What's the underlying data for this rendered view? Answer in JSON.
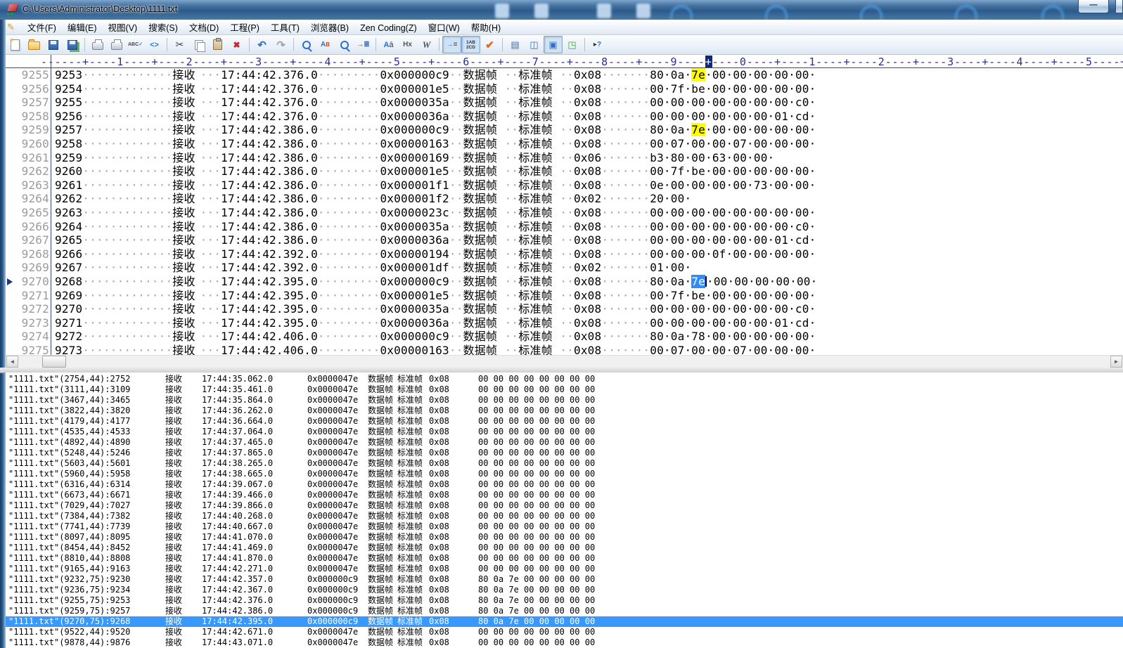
{
  "window": {
    "title": "C:\\Users\\Administrator\\Desktop\\1111.txt",
    "minimize_label": "—"
  },
  "menu": {
    "items": [
      "文件(F)",
      "编辑(E)",
      "视图(V)",
      "搜索(S)",
      "文档(D)",
      "工程(P)",
      "工具(T)",
      "浏览器(B)",
      "Zen Coding(Z)",
      "窗口(W)",
      "帮助(H)"
    ]
  },
  "toolbar": {
    "buttons": [
      {
        "name": "new-file-button",
        "glyph": "page"
      },
      {
        "name": "open-file-button",
        "glyph": "folder"
      },
      {
        "name": "save-button",
        "glyph": "disk"
      },
      {
        "name": "save-all-button",
        "glyph": "disks"
      },
      {
        "sep": true
      },
      {
        "name": "print-preview-button",
        "glyph": "printpre"
      },
      {
        "name": "print-button",
        "glyph": "printer"
      },
      {
        "name": "spell-check-button",
        "glyph": "abc"
      },
      {
        "name": "html-bar-button",
        "glyph": "code"
      },
      {
        "sep": true
      },
      {
        "name": "cut-button",
        "glyph": "cut"
      },
      {
        "name": "copy-button",
        "glyph": "copy"
      },
      {
        "name": "paste-button",
        "glyph": "paste"
      },
      {
        "name": "delete-button",
        "glyph": "del"
      },
      {
        "sep": true
      },
      {
        "name": "undo-button",
        "glyph": "undo"
      },
      {
        "name": "redo-button",
        "glyph": "redo"
      },
      {
        "sep": true
      },
      {
        "name": "find-button",
        "glyph": "find"
      },
      {
        "name": "replace-button",
        "glyph": "replace"
      },
      {
        "name": "find-in-files-button",
        "glyph": "findfiles"
      },
      {
        "name": "goto-line-button",
        "glyph": "goto"
      },
      {
        "sep": true
      },
      {
        "name": "fullwidth-convert-button",
        "glyph": "aa"
      },
      {
        "name": "hex-viewer-button",
        "glyph": "hx"
      },
      {
        "name": "word-wrap-button",
        "glyph": "w"
      },
      {
        "sep": true
      },
      {
        "name": "show-whitespace-button",
        "glyph": "ws",
        "pressed": true
      },
      {
        "name": "line-numbers-button",
        "glyph": "ln",
        "pressed": true
      },
      {
        "name": "syntax-check-button",
        "glyph": "check"
      },
      {
        "sep": true
      },
      {
        "name": "document-list-button",
        "glyph": "doclist"
      },
      {
        "name": "window-split-button",
        "glyph": "split"
      },
      {
        "name": "output-window-button",
        "glyph": "outwin",
        "pressed": true
      },
      {
        "name": "browser-view-button",
        "glyph": "browser"
      },
      {
        "sep": true
      },
      {
        "name": "context-help-button",
        "glyph": "help"
      }
    ]
  },
  "ruler": {
    "cursor_col": 95
  },
  "editor": {
    "receive_label": "接收",
    "frame_type": "数据帧",
    "frame_format": "标准帧",
    "current_line": 9270,
    "rows": [
      {
        "line": 9255,
        "seq": "9253",
        "time": "17:44:42.376.0",
        "id": "0x000000c9",
        "dlc": "0x08",
        "data": "80 0a 7e 00 00 00 00 00",
        "hl": "yellow",
        "hl_byte": 2
      },
      {
        "line": 9256,
        "seq": "9254",
        "time": "17:44:42.376.0",
        "id": "0x000001e5",
        "dlc": "0x08",
        "data": "00 7f be 00 00 00 00 00"
      },
      {
        "line": 9257,
        "seq": "9255",
        "time": "17:44:42.376.0",
        "id": "0x0000035a",
        "dlc": "0x08",
        "data": "00 00 00 00 00 00 00 c0"
      },
      {
        "line": 9258,
        "seq": "9256",
        "time": "17:44:42.376.0",
        "id": "0x0000036a",
        "dlc": "0x08",
        "data": "00 00 00 00 00 00 01 cd"
      },
      {
        "line": 9259,
        "seq": "9257",
        "time": "17:44:42.386.0",
        "id": "0x000000c9",
        "dlc": "0x08",
        "data": "80 0a 7e 00 00 00 00 00",
        "hl": "yellow",
        "hl_byte": 2
      },
      {
        "line": 9260,
        "seq": "9258",
        "time": "17:44:42.386.0",
        "id": "0x00000163",
        "dlc": "0x08",
        "data": "00 07 00 00 07 00 00 00"
      },
      {
        "line": 9261,
        "seq": "9259",
        "time": "17:44:42.386.0",
        "id": "0x00000169",
        "dlc": "0x06",
        "data": "b3 80 00 63 00 00"
      },
      {
        "line": 9262,
        "seq": "9260",
        "time": "17:44:42.386.0",
        "id": "0x000001e5",
        "dlc": "0x08",
        "data": "00 7f be 00 00 00 00 00"
      },
      {
        "line": 9263,
        "seq": "9261",
        "time": "17:44:42.386.0",
        "id": "0x000001f1",
        "dlc": "0x08",
        "data": "0e 00 00 00 00 73 00 00"
      },
      {
        "line": 9264,
        "seq": "9262",
        "time": "17:44:42.386.0",
        "id": "0x000001f2",
        "dlc": "0x02",
        "data": "20 00"
      },
      {
        "line": 9265,
        "seq": "9263",
        "time": "17:44:42.386.0",
        "id": "0x0000023c",
        "dlc": "0x08",
        "data": "00 00 00 00 00 00 00 00"
      },
      {
        "line": 9266,
        "seq": "9264",
        "time": "17:44:42.386.0",
        "id": "0x0000035a",
        "dlc": "0x08",
        "data": "00 00 00 00 00 00 00 c0"
      },
      {
        "line": 9267,
        "seq": "9265",
        "time": "17:44:42.386.0",
        "id": "0x0000036a",
        "dlc": "0x08",
        "data": "00 00 00 00 00 00 01 cd"
      },
      {
        "line": 9268,
        "seq": "9266",
        "time": "17:44:42.392.0",
        "id": "0x00000194",
        "dlc": "0x08",
        "data": "00 00 00 0f 00 00 00 00"
      },
      {
        "line": 9269,
        "seq": "9267",
        "time": "17:44:42.392.0",
        "id": "0x000001df",
        "dlc": "0x02",
        "data": "01 00"
      },
      {
        "line": 9270,
        "seq": "9268",
        "time": "17:44:42.395.0",
        "id": "0x000000c9",
        "dlc": "0x08",
        "data": "80 0a 7e 00 00 00 00 00",
        "hl": "selection",
        "hl_byte": 2
      },
      {
        "line": 9271,
        "seq": "9269",
        "time": "17:44:42.395.0",
        "id": "0x000001e5",
        "dlc": "0x08",
        "data": "00 7f be 00 00 00 00 00"
      },
      {
        "line": 9272,
        "seq": "9270",
        "time": "17:44:42.395.0",
        "id": "0x0000035a",
        "dlc": "0x08",
        "data": "00 00 00 00 00 00 00 c0"
      },
      {
        "line": 9273,
        "seq": "9271",
        "time": "17:44:42.395.0",
        "id": "0x0000036a",
        "dlc": "0x08",
        "data": "00 00 00 00 00 00 01 cd"
      },
      {
        "line": 9274,
        "seq": "9272",
        "time": "17:44:42.406.0",
        "id": "0x000000c9",
        "dlc": "0x08",
        "data": "80 0a 78 00 00 00 00 00"
      },
      {
        "line": 9275,
        "seq": "9273",
        "time": "17:44:42.406.0",
        "id": "0x00000163",
        "dlc": "0x08",
        "data": "00 07 00 00 07 00 00 00"
      }
    ]
  },
  "search_results": {
    "receive_label": "接收",
    "frame_type": "数据帧",
    "frame_format": "标准帧",
    "rows": [
      {
        "ref": "\"1111.txt\"(2754,44):2752",
        "time": "17:44:35.062.0",
        "id": "0x0000047e",
        "dlc": "0x08",
        "data": "00 00 00 00 00 00 00 00"
      },
      {
        "ref": "\"1111.txt\"(3111,44):3109",
        "time": "17:44:35.461.0",
        "id": "0x0000047e",
        "dlc": "0x08",
        "data": "00 00 00 00 00 00 00 00"
      },
      {
        "ref": "\"1111.txt\"(3467,44):3465",
        "time": "17:44:35.864.0",
        "id": "0x0000047e",
        "dlc": "0x08",
        "data": "00 00 00 00 00 00 00 00"
      },
      {
        "ref": "\"1111.txt\"(3822,44):3820",
        "time": "17:44:36.262.0",
        "id": "0x0000047e",
        "dlc": "0x08",
        "data": "00 00 00 00 00 00 00 00"
      },
      {
        "ref": "\"1111.txt\"(4179,44):4177",
        "time": "17:44:36.664.0",
        "id": "0x0000047e",
        "dlc": "0x08",
        "data": "00 00 00 00 00 00 00 00"
      },
      {
        "ref": "\"1111.txt\"(4535,44):4533",
        "time": "17:44:37.064.0",
        "id": "0x0000047e",
        "dlc": "0x08",
        "data": "00 00 00 00 00 00 00 00"
      },
      {
        "ref": "\"1111.txt\"(4892,44):4890",
        "time": "17:44:37.465.0",
        "id": "0x0000047e",
        "dlc": "0x08",
        "data": "00 00 00 00 00 00 00 00"
      },
      {
        "ref": "\"1111.txt\"(5248,44):5246",
        "time": "17:44:37.865.0",
        "id": "0x0000047e",
        "dlc": "0x08",
        "data": "00 00 00 00 00 00 00 00"
      },
      {
        "ref": "\"1111.txt\"(5603,44):5601",
        "time": "17:44:38.265.0",
        "id": "0x0000047e",
        "dlc": "0x08",
        "data": "00 00 00 00 00 00 00 00"
      },
      {
        "ref": "\"1111.txt\"(5960,44):5958",
        "time": "17:44:38.665.0",
        "id": "0x0000047e",
        "dlc": "0x08",
        "data": "00 00 00 00 00 00 00 00"
      },
      {
        "ref": "\"1111.txt\"(6316,44):6314",
        "time": "17:44:39.067.0",
        "id": "0x0000047e",
        "dlc": "0x08",
        "data": "00 00 00 00 00 00 00 00"
      },
      {
        "ref": "\"1111.txt\"(6673,44):6671",
        "time": "17:44:39.466.0",
        "id": "0x0000047e",
        "dlc": "0x08",
        "data": "00 00 00 00 00 00 00 00"
      },
      {
        "ref": "\"1111.txt\"(7029,44):7027",
        "time": "17:44:39.866.0",
        "id": "0x0000047e",
        "dlc": "0x08",
        "data": "00 00 00 00 00 00 00 00"
      },
      {
        "ref": "\"1111.txt\"(7384,44):7382",
        "time": "17:44:40.268.0",
        "id": "0x0000047e",
        "dlc": "0x08",
        "data": "00 00 00 00 00 00 00 00"
      },
      {
        "ref": "\"1111.txt\"(7741,44):7739",
        "time": "17:44:40.667.0",
        "id": "0x0000047e",
        "dlc": "0x08",
        "data": "00 00 00 00 00 00 00 00"
      },
      {
        "ref": "\"1111.txt\"(8097,44):8095",
        "time": "17:44:41.070.0",
        "id": "0x0000047e",
        "dlc": "0x08",
        "data": "00 00 00 00 00 00 00 00"
      },
      {
        "ref": "\"1111.txt\"(8454,44):8452",
        "time": "17:44:41.469.0",
        "id": "0x0000047e",
        "dlc": "0x08",
        "data": "00 00 00 00 00 00 00 00"
      },
      {
        "ref": "\"1111.txt\"(8810,44):8808",
        "time": "17:44:41.870.0",
        "id": "0x0000047e",
        "dlc": "0x08",
        "data": "00 00 00 00 00 00 00 00"
      },
      {
        "ref": "\"1111.txt\"(9165,44):9163",
        "time": "17:44:42.271.0",
        "id": "0x0000047e",
        "dlc": "0x08",
        "data": "00 00 00 00 00 00 00 00"
      },
      {
        "ref": "\"1111.txt\"(9232,75):9230",
        "time": "17:44:42.357.0",
        "id": "0x000000c9",
        "dlc": "0x08",
        "data": "80 0a 7e 00 00 00 00 00"
      },
      {
        "ref": "\"1111.txt\"(9236,75):9234",
        "time": "17:44:42.367.0",
        "id": "0x000000c9",
        "dlc": "0x08",
        "data": "80 0a 7e 00 00 00 00 00"
      },
      {
        "ref": "\"1111.txt\"(9255,75):9253",
        "time": "17:44:42.376.0",
        "id": "0x000000c9",
        "dlc": "0x08",
        "data": "80 0a 7e 00 00 00 00 00"
      },
      {
        "ref": "\"1111.txt\"(9259,75):9257",
        "time": "17:44:42.386.0",
        "id": "0x000000c9",
        "dlc": "0x08",
        "data": "80 0a 7e 00 00 00 00 00"
      },
      {
        "ref": "\"1111.txt\"(9270,75):9268",
        "time": "17:44:42.395.0",
        "id": "0x000000c9",
        "dlc": "0x08",
        "data": "80 0a 7e 00 00 00 00 00",
        "selected": true
      },
      {
        "ref": "\"1111.txt\"(9522,44):9520",
        "time": "17:44:42.671.0",
        "id": "0x0000047e",
        "dlc": "0x08",
        "data": "00 00 00 00 00 00 00 00"
      },
      {
        "ref": "\"1111.txt\"(9878,44):9876",
        "time": "17:44:43.071.0",
        "id": "0x0000047e",
        "dlc": "0x08",
        "data": "00 00 00 00 00 00 00 00"
      }
    ]
  },
  "colors": {
    "selection": "#3898fd",
    "search_highlight": "#ffff00",
    "ruler_cursor": "#0f2a7a",
    "titlebar": "#2c5a8a"
  }
}
